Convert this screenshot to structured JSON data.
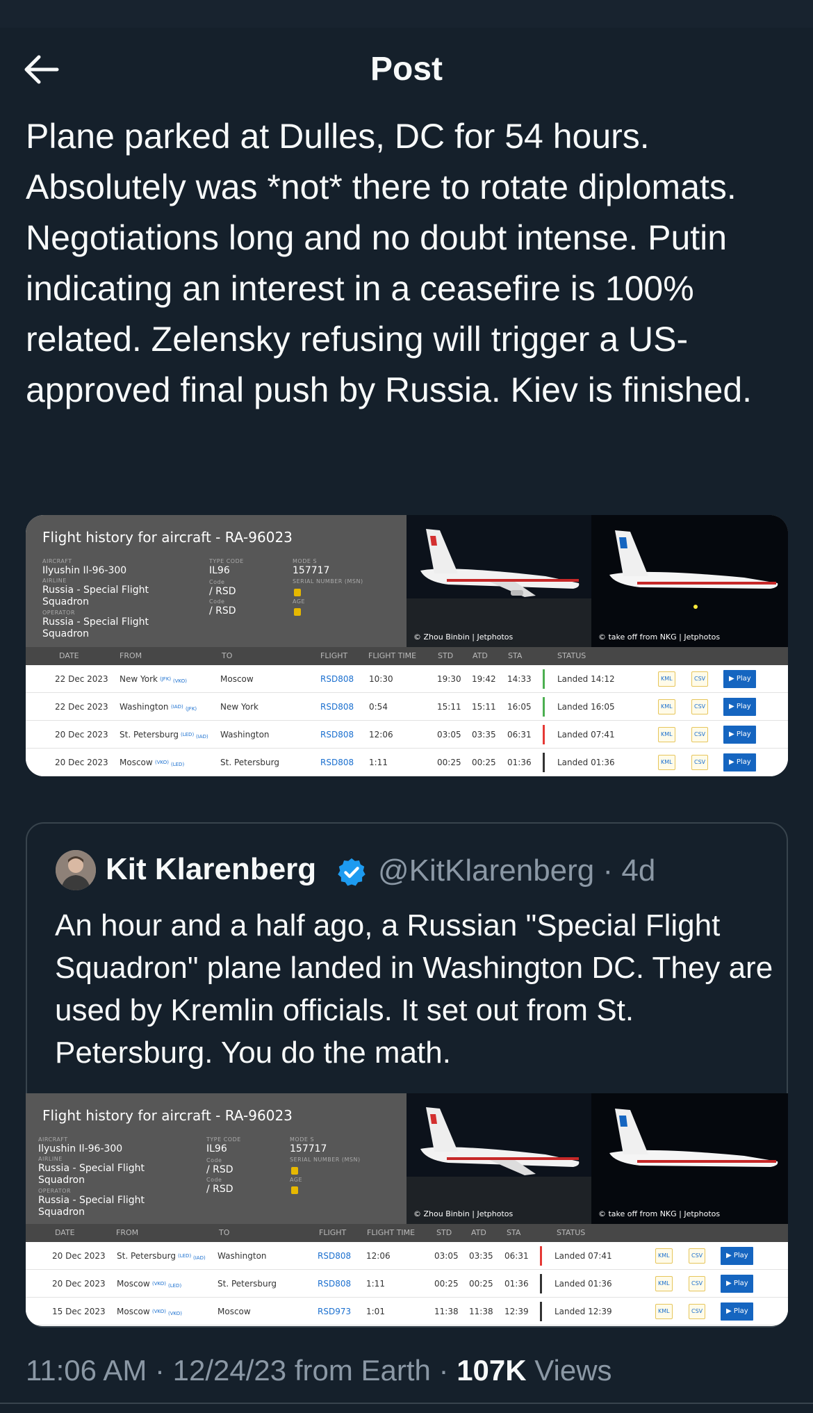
{
  "header": {
    "title": "Post"
  },
  "post": {
    "text": "Plane parked at Dulles, DC for 54 hours. Absolutely was *not* there to rotate diplomats. Negotiations long and no doubt intense. Putin indicating an interest in a ceasefire is 100% related. Zelensky refusing will trigger a US-approved final push by Russia. Kiev is finished."
  },
  "flight_card_1": {
    "title": "Flight history for aircraft - RA-96023",
    "aircraft_label": "AIRCRAFT",
    "aircraft": "Ilyushin Il-96-300",
    "airline_label": "AIRLINE",
    "airline": "Russia - Special Flight Squadron",
    "operator_label": "OPERATOR",
    "operator": "Russia - Special Flight Squadron",
    "type_code_label": "TYPE CODE",
    "type_code": "IL96",
    "code_label": "Code",
    "code1": "/ RSD",
    "code2": "/ RSD",
    "mode_s_label": "MODE S",
    "mode_s": "157717",
    "serial_label": "SERIAL NUMBER (MSN)",
    "age_label": "AGE",
    "photo1_caption": "© Zhou Binbin | Jetphotos",
    "photo2_caption": "© take off from NKG | Jetphotos",
    "columns": [
      "DATE",
      "FROM",
      "TO",
      "FLIGHT",
      "FLIGHT TIME",
      "STD",
      "ATD",
      "STA",
      "STATUS"
    ],
    "rows": [
      {
        "date": "22 Dec 2023",
        "from": "New York",
        "from_code": "(JFK)",
        "to": "Moscow",
        "to_code": "(VKO)",
        "flight": "RSD808",
        "time": "10:30",
        "std": "19:30",
        "atd": "19:42",
        "sta": "14:33",
        "status": "Landed 14:12",
        "bar": "#4caf50"
      },
      {
        "date": "22 Dec 2023",
        "from": "Washington",
        "from_code": "(IAD)",
        "to": "New York",
        "to_code": "(JFK)",
        "flight": "RSD808",
        "time": "0:54",
        "std": "15:11",
        "atd": "15:11",
        "sta": "16:05",
        "status": "Landed 16:05",
        "bar": "#4caf50"
      },
      {
        "date": "20 Dec 2023",
        "from": "St. Petersburg",
        "from_code": "(LED)",
        "to": "Washington",
        "to_code": "(IAD)",
        "flight": "RSD808",
        "time": "12:06",
        "std": "03:05",
        "atd": "03:35",
        "sta": "06:31",
        "status": "Landed 07:41",
        "bar": "#e53935"
      },
      {
        "date": "20 Dec 2023",
        "from": "Moscow",
        "from_code": "(VKO)",
        "to": "St. Petersburg",
        "to_code": "(LED)",
        "flight": "RSD808",
        "time": "1:11",
        "std": "00:25",
        "atd": "00:25",
        "sta": "01:36",
        "status": "Landed 01:36",
        "bar": "#333333"
      }
    ],
    "kml": "KML",
    "csv": "CSV",
    "play": "▶ Play"
  },
  "quote": {
    "name": "Kit Klarenberg",
    "handle": "@KitKlarenberg · 4d",
    "text": "An hour and a half ago, a Russian \"Special Flight Squadron\" plane landed in Washington DC. They are used by Kremlin officials. It set out from St. Petersburg. You do the math."
  },
  "flight_card_2": {
    "title": "Flight history for aircraft - RA-96023",
    "rows": [
      {
        "date": "20 Dec 2023",
        "from": "St. Petersburg",
        "from_code": "(LED)",
        "to": "Washington",
        "to_code": "(IAD)",
        "flight": "RSD808",
        "time": "12:06",
        "std": "03:05",
        "atd": "03:35",
        "sta": "06:31",
        "status": "Landed 07:41",
        "bar": "#e53935"
      },
      {
        "date": "20 Dec 2023",
        "from": "Moscow",
        "from_code": "(VKO)",
        "to": "St. Petersburg",
        "to_code": "(LED)",
        "flight": "RSD808",
        "time": "1:11",
        "std": "00:25",
        "atd": "00:25",
        "sta": "01:36",
        "status": "Landed 01:36",
        "bar": "#333333"
      },
      {
        "date": "15 Dec 2023",
        "from": "Moscow",
        "from_code": "(VKO)",
        "to": "Moscow",
        "to_code": "(VKO)",
        "flight": "RSD973",
        "time": "1:01",
        "std": "11:38",
        "atd": "11:38",
        "sta": "12:39",
        "status": "Landed 12:39",
        "bar": "#333333"
      }
    ]
  },
  "meta": {
    "time_date": "11:06 AM · 12/24/23 from Earth · ",
    "views_count": "107K",
    "views_label": " Views"
  },
  "colors": {
    "background": "#15202b",
    "text": "#f7f9f9",
    "muted": "#8b98a5",
    "verified": "#1d9bf0"
  }
}
